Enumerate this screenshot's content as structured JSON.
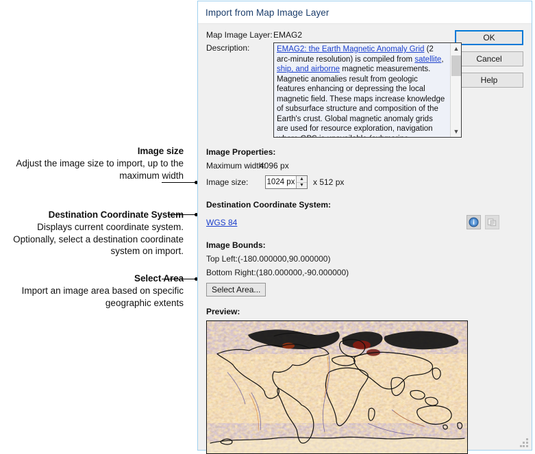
{
  "dialog": {
    "title": "Import from Map Image Layer",
    "layer_label": "Map Image Layer:",
    "layer_value": "EMAG2",
    "description_label": "Description:",
    "description_segments": [
      {
        "text": "EMAG2: the Earth Magnetic Anomaly Grid",
        "link": true
      },
      {
        "text": " (2 arc-minute resolution) is compiled from ",
        "link": false
      },
      {
        "text": "satellite",
        "link": true
      },
      {
        "text": ", ",
        "link": false
      },
      {
        "text": "ship, and airborne",
        "link": true
      },
      {
        "text": " magnetic measurements. Magnetic anomalies result from geologic features enhancing or depressing the local magnetic field. These maps increase knowledge of subsurface structure and composition of the Earth's crust. Global magnetic anomaly grids are used for resource exploration, navigation where GPS is unavailable (submarine, directional drilling, etc.), and for studying the evolution of the lithosphere.",
        "link": false
      }
    ],
    "buttons": {
      "ok": "OK",
      "cancel": "Cancel",
      "help": "Help"
    },
    "image_properties": {
      "heading": "Image Properties:",
      "maximum_width_label": "Maximum width:",
      "maximum_width_value": "4096 px",
      "image_size_label": "Image size:",
      "image_size_value": "1024 px",
      "image_size_suffix": "x 512 px"
    },
    "destination_coordinate_system": {
      "heading": "Destination Coordinate System:",
      "value": "WGS 84",
      "info_icon": "info-icon",
      "copy_icon": "copy-paste-icon"
    },
    "image_bounds": {
      "heading": "Image Bounds:",
      "top_left": "Top Left:(-180.000000,90.000000)",
      "bottom_right": "Bottom Right:(180.000000,-90.000000)"
    },
    "select_area_button": "Select Area...",
    "preview": {
      "heading": "Preview:"
    }
  },
  "annotations": [
    {
      "title": "Image size",
      "body": "Adjust the image size to import, up to the maximum width"
    },
    {
      "title": "Destination Coordinate System",
      "body": "Displays current coordinate system. Optionally, select a destination coordinate system on import."
    },
    {
      "title": "Select Area",
      "body": "Import an image area based on specific geographic extents"
    }
  ],
  "colors": {
    "dialog_background": "#f0f0f0",
    "dialog_border": "#9fd0ee",
    "link": "#1b3fcc",
    "title": "#1b3d6b",
    "accent_focus": "#0078d7",
    "description_background": "#eef1f8",
    "map_background": "#fdf4d8",
    "map_warm": "#e08020",
    "map_cool": "#6a5fae",
    "map_coast": "#111111"
  }
}
